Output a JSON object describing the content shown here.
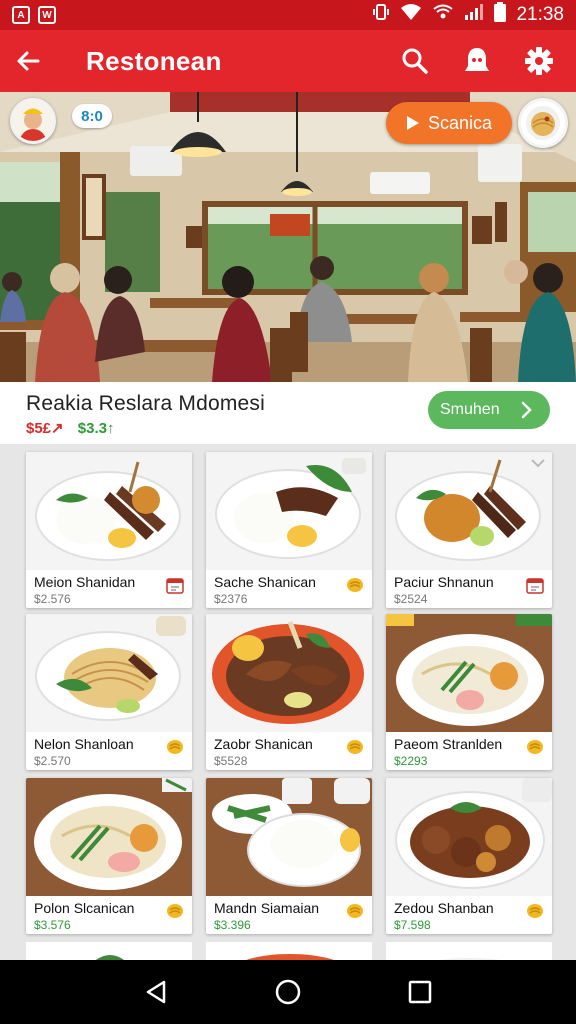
{
  "status_bar": {
    "time": "21:38",
    "left_box_a": "A",
    "left_box_b": "W"
  },
  "app_bar": {
    "title": "Restonean"
  },
  "hero": {
    "badge": "8:0",
    "scan_label": "Scanica"
  },
  "restaurant": {
    "title": "Reakia Reslara  Mdomesi",
    "price_old": "$5£↗",
    "price_new": "$3.3↑",
    "action_label": "Smuhen"
  },
  "colors": {
    "status_bar": "#c8171c",
    "app_bar": "#e3262c",
    "scan_button": "#f27428",
    "action_button": "#5cb85c",
    "price_old": "#d92b2b",
    "price_new": "#2f9a38"
  },
  "menu": [
    {
      "name": "Meion Shanidan",
      "price": "$2.576",
      "icon": "receipt-icon"
    },
    {
      "name": "Sache Shanican",
      "price": "$2376",
      "icon": "coin-icon"
    },
    {
      "name": "Paciur  Shnanun",
      "price": "$2524",
      "icon": "receipt-icon"
    },
    {
      "name": "Nelon Shanloan",
      "price": "$2.570",
      "icon": "coin-icon"
    },
    {
      "name": "Zaobr Shanican",
      "price": "$5528",
      "icon": "coin-icon"
    },
    {
      "name": "Paeom Stranlden",
      "price": "$2293",
      "icon": "coin-icon"
    },
    {
      "name": "Polon Slcanican",
      "price": "$3.576",
      "icon": "coin-icon"
    },
    {
      "name": "Mandn Siamaian",
      "price": "$3.396",
      "icon": "coin-icon"
    },
    {
      "name": "Zedou Shanban",
      "price": "$7.598",
      "icon": "coin-icon"
    }
  ]
}
